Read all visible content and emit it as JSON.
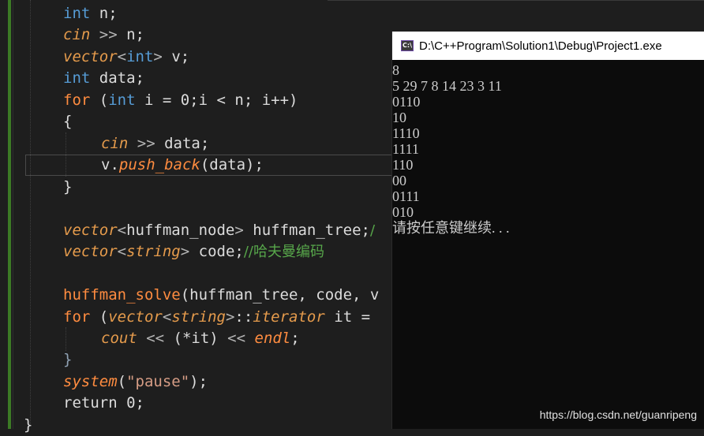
{
  "editor": {
    "lines": [
      {
        "id": "l1",
        "tokens": [
          {
            "c": "kw",
            "t": "int"
          },
          {
            "c": "txt",
            "t": " n;"
          }
        ]
      },
      {
        "id": "l2",
        "tokens": [
          {
            "c": "ty",
            "t": "cin"
          },
          {
            "c": "op",
            "t": " >> "
          },
          {
            "c": "txt",
            "t": "n;"
          }
        ]
      },
      {
        "id": "l3",
        "tokens": [
          {
            "c": "ty",
            "t": "vector"
          },
          {
            "c": "op",
            "t": "<"
          },
          {
            "c": "kw",
            "t": "int"
          },
          {
            "c": "op",
            "t": ">"
          },
          {
            "c": "txt",
            "t": " v;"
          }
        ]
      },
      {
        "id": "l4",
        "tokens": [
          {
            "c": "kw",
            "t": "int"
          },
          {
            "c": "txt",
            "t": " data;"
          }
        ]
      },
      {
        "id": "l5",
        "tokens": [
          {
            "c": "fnn",
            "t": "for"
          },
          {
            "c": "txt",
            "t": " ("
          },
          {
            "c": "kw",
            "t": "int"
          },
          {
            "c": "txt",
            "t": " i = 0;i < n; i++)"
          }
        ]
      },
      {
        "id": "l6",
        "tokens": [
          {
            "c": "txt",
            "t": "{"
          }
        ]
      },
      {
        "id": "l7",
        "tokens": [
          {
            "c": "ty",
            "t": "cin"
          },
          {
            "c": "op",
            "t": " >> "
          },
          {
            "c": "txt",
            "t": "data;"
          }
        ]
      },
      {
        "id": "l8",
        "tokens": [
          {
            "c": "txt",
            "t": "v."
          },
          {
            "c": "fn",
            "t": "push_back"
          },
          {
            "c": "txt",
            "t": "(data);"
          }
        ]
      },
      {
        "id": "l9",
        "tokens": [
          {
            "c": "txt",
            "t": "}"
          }
        ]
      },
      {
        "id": "l10",
        "tokens": []
      },
      {
        "id": "l11",
        "tokens": [
          {
            "c": "ty",
            "t": "vector"
          },
          {
            "c": "op",
            "t": "<"
          },
          {
            "c": "txt",
            "t": "huffman_node"
          },
          {
            "c": "op",
            "t": ">"
          },
          {
            "c": "txt",
            "t": " huffman_tree;"
          },
          {
            "c": "cmt",
            "t": "/"
          }
        ]
      },
      {
        "id": "l12",
        "tokens": [
          {
            "c": "ty",
            "t": "vector"
          },
          {
            "c": "op",
            "t": "<"
          },
          {
            "c": "ty",
            "t": "string"
          },
          {
            "c": "op",
            "t": ">"
          },
          {
            "c": "txt",
            "t": " code;"
          },
          {
            "c": "cmt",
            "t": "//哈夫曼编码"
          }
        ]
      },
      {
        "id": "l13",
        "tokens": []
      },
      {
        "id": "l14",
        "tokens": [
          {
            "c": "fnn",
            "t": "huffman_solve"
          },
          {
            "c": "txt",
            "t": "(huffman_tree, code, v"
          }
        ]
      },
      {
        "id": "l15",
        "tokens": [
          {
            "c": "fnn",
            "t": "for"
          },
          {
            "c": "txt",
            "t": " ("
          },
          {
            "c": "ty",
            "t": "vector"
          },
          {
            "c": "op",
            "t": "<"
          },
          {
            "c": "ty",
            "t": "string"
          },
          {
            "c": "op",
            "t": ">"
          },
          {
            "c": "txt",
            "t": "::"
          },
          {
            "c": "ty",
            "t": "iterator"
          },
          {
            "c": "txt",
            "t": " it ="
          }
        ]
      },
      {
        "id": "l16",
        "tokens": [
          {
            "c": "ty",
            "t": "cout"
          },
          {
            "c": "op",
            "t": " << "
          },
          {
            "c": "txt",
            "t": "(*it)"
          },
          {
            "c": "op",
            "t": " << "
          },
          {
            "c": "fn",
            "t": "endl"
          },
          {
            "c": "txt",
            "t": ";"
          }
        ]
      },
      {
        "id": "l17",
        "tokens": [
          {
            "c": "rbrace",
            "t": "}"
          }
        ]
      },
      {
        "id": "l18",
        "tokens": [
          {
            "c": "fn",
            "t": "system"
          },
          {
            "c": "txt",
            "t": "("
          },
          {
            "c": "str",
            "t": "\"pause\""
          },
          {
            "c": "txt",
            "t": ");"
          }
        ]
      },
      {
        "id": "l19",
        "tokens": [
          {
            "c": "txt",
            "t": "return 0;"
          }
        ]
      },
      {
        "id": "l20",
        "tokens": [
          {
            "c": "txt",
            "t": "}"
          }
        ]
      }
    ]
  },
  "console": {
    "title": "D:\\C++Program\\Solution1\\Debug\\Project1.exe",
    "icon": "console-app-icon",
    "icon_label": "C:\\",
    "output": [
      "8",
      "5 29 7 8 14 23 3 11",
      "0110",
      "10",
      "1110",
      "1111",
      "110",
      "00",
      "0111",
      "010",
      "请按任意键继续. . ."
    ]
  },
  "watermark": "https://blog.csdn.net/guanripeng",
  "colors": {
    "keyword": "#569cd6",
    "type": "#e59b4c",
    "function": "#ff8c40",
    "comment": "#57a64a",
    "string": "#d69d85",
    "editor_bg": "#1e1e1e",
    "console_bg": "#0c0c0c",
    "change_bar": "#3c7a25"
  }
}
